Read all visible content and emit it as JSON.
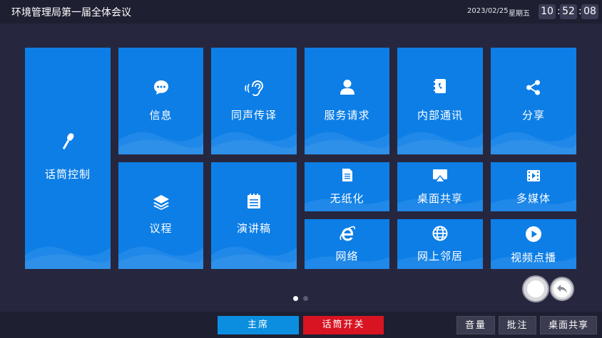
{
  "header": {
    "title": "环境管理局第一届全体会议",
    "date": "2023/02/25",
    "weekday": "星期五",
    "clock": {
      "hours": "10",
      "minutes": "52",
      "seconds": "08",
      "separator": ":"
    }
  },
  "tiles": {
    "mic_control": "话筒控制",
    "message": "信息",
    "interpretation": "同声传译",
    "service_request": "服务请求",
    "internal_comm": "内部通讯",
    "share": "分享",
    "agenda": "议程",
    "speech": "演讲稿",
    "paperless": "无纸化",
    "desktop_share": "桌面共享",
    "multimedia": "多媒体",
    "network": "网络",
    "neighbors": "网上邻居",
    "video_on_demand": "视频点播"
  },
  "pagination": {
    "current": 1,
    "total": 2
  },
  "footer": {
    "chair": "主席",
    "mic_switch": "话筒开关",
    "volume": "音量",
    "annotate": "批注",
    "desktop_share": "桌面共享"
  },
  "colors": {
    "background": "#26273f",
    "bars": "#1e1f31",
    "tile": "#0d7ee6",
    "chair_button": "#0c8ee0",
    "mic_button": "#d81422"
  },
  "icons": {
    "mic_control": "microphone-icon",
    "message": "chat-bubble-icon",
    "interpretation": "ear-icon",
    "service_request": "person-icon",
    "internal_comm": "phone-book-icon",
    "share": "share-icon",
    "agenda": "layers-icon",
    "speech": "notepad-icon",
    "paperless": "document-icon",
    "desktop_share": "screen-cast-icon",
    "multimedia": "film-icon",
    "network": "browser-e-icon",
    "neighbors": "globe-icon",
    "video_on_demand": "play-circle-icon"
  }
}
